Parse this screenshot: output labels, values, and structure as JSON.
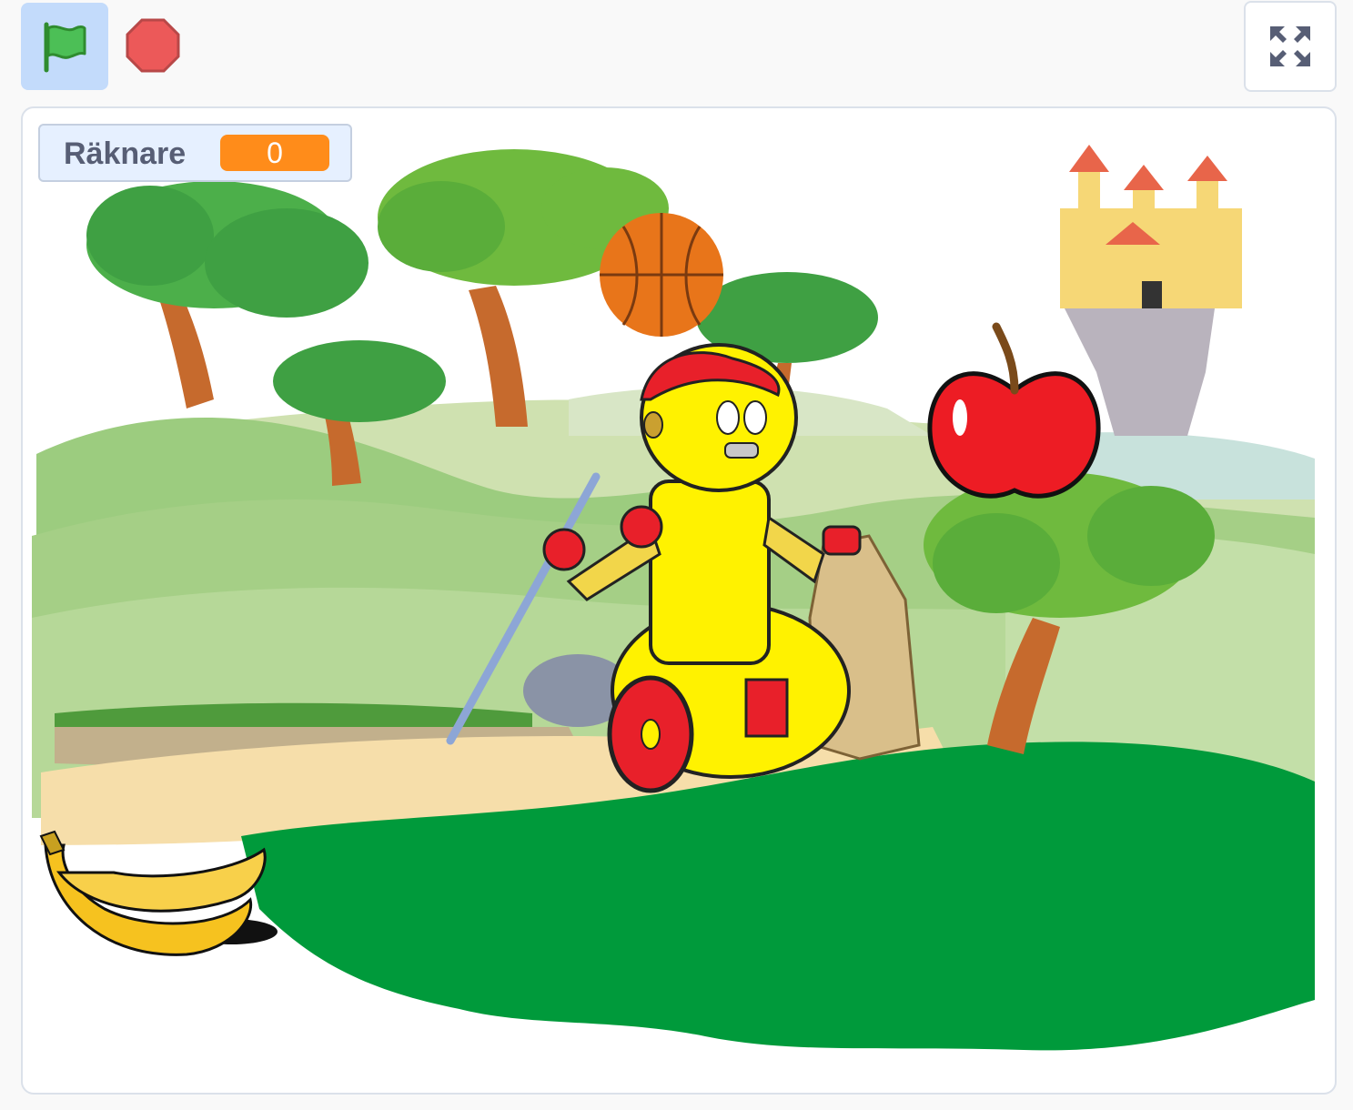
{
  "toolbar": {
    "green_flag_icon": "green-flag-icon",
    "stop_icon": "stop-sign-icon",
    "fullscreen_icon": "fullscreen-icon"
  },
  "stage": {
    "variable_monitor": {
      "label": "Räknare",
      "value": "0"
    }
  },
  "colors": {
    "flag_active_bg": "#c3dbfb",
    "monitor_value_bg": "#ff8c1a",
    "grass": "#009a3b"
  }
}
